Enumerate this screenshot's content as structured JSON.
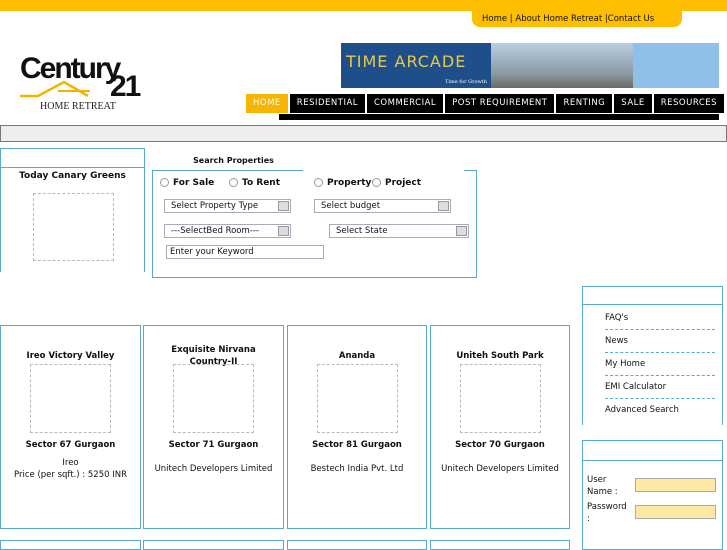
{
  "top_links": {
    "home": "Home",
    "about": "About Home Retreat",
    "contact": "Contact Us"
  },
  "logo": {
    "brand": "Century 21",
    "sub": "HOME RETREAT"
  },
  "banner": {
    "title": "TIME ARCADE",
    "tagline": "Time for Growth"
  },
  "nav": [
    "HOME",
    "RESIDENTIAL",
    "COMMERCIAL",
    "POST REQUIREMENT",
    "RENTING",
    "SALE",
    "RESOURCES"
  ],
  "featured": {
    "title": "Today Canary Greens"
  },
  "search": {
    "title": "Search Properties",
    "radios": [
      "For Sale",
      "To Rent",
      "Property",
      "Project"
    ],
    "property_type": "Select Property Type",
    "budget": "Select budget",
    "bedroom": "---SelectBed Room---",
    "state": "Select State",
    "keyword_placeholder": "Enter your Keyword"
  },
  "cards": [
    {
      "name": "Ireo Victory Valley",
      "location": "Sector 67 Gurgaon",
      "developer": "Ireo",
      "price": "Price (per sqft.) : 5250 INR"
    },
    {
      "name": "Exquisite Nirvana Country-II",
      "location": "Sector 71 Gurgaon",
      "developer": "Unitech Developers Limited"
    },
    {
      "name": "Ananda",
      "location": "Sector 81 Gurgaon",
      "developer": "Bestech India Pvt. Ltd"
    },
    {
      "name": "Uniteh South Park",
      "location": "Sector 70 Gurgaon",
      "developer": "Unitech Developers Limited"
    }
  ],
  "side_menu": [
    "FAQ's",
    "News",
    "My Home",
    "EMI Calculator",
    "Advanced Search"
  ],
  "login": {
    "username_label": "User Name :",
    "password_label": "Password :"
  },
  "colors": {
    "accent": "#fdbf00",
    "border": "#5aaacb"
  }
}
